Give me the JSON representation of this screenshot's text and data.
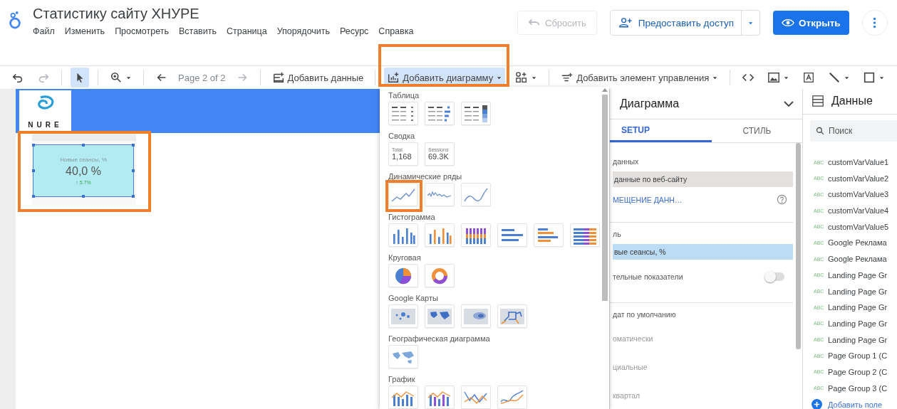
{
  "app": {
    "title": "Статистику сайту ХНУРЕ",
    "menu": [
      "Файл",
      "Изменить",
      "Просмотреть",
      "Вставить",
      "Страница",
      "Упорядочить",
      "Ресурс",
      "Справка"
    ]
  },
  "header_actions": {
    "reset": {
      "label": "Сбросить",
      "disabled": true
    },
    "share": {
      "label": "Предоставить доступ"
    },
    "open": {
      "label": "Открыть"
    }
  },
  "toolbar": [
    {
      "kind": "undo",
      "selected": false,
      "disabled": false
    },
    {
      "kind": "redo",
      "selected": false,
      "disabled": true
    },
    {
      "kind": "separator"
    },
    {
      "kind": "select",
      "selected": true,
      "disabled": false
    },
    {
      "kind": "separator"
    },
    {
      "kind": "zoom",
      "selected": false,
      "disabled": false,
      "caret": true
    },
    {
      "kind": "separator"
    },
    {
      "kind": "prev",
      "selected": false,
      "disabled": false
    },
    {
      "kind": "page",
      "label": "Page 2 of 2",
      "selected": false,
      "disabled": true
    },
    {
      "kind": "next",
      "selected": false,
      "disabled": true
    },
    {
      "kind": "separator"
    },
    {
      "kind": "add-data",
      "label": "Добавить данные",
      "selected": false,
      "disabled": false
    },
    {
      "kind": "separator"
    },
    {
      "kind": "add-chart",
      "label": "Добавить диаграмму",
      "selected": true,
      "disabled": false,
      "caret": true
    },
    {
      "kind": "component",
      "selected": false,
      "disabled": false,
      "caret": true
    },
    {
      "kind": "separator"
    },
    {
      "kind": "add-control",
      "label": "Добавить элемент управления",
      "selected": false,
      "disabled": false,
      "caret": true
    },
    {
      "kind": "separator"
    },
    {
      "kind": "code",
      "selected": false,
      "disabled": false
    },
    {
      "kind": "image",
      "selected": false,
      "disabled": false,
      "caret": true
    },
    {
      "kind": "text",
      "selected": false,
      "disabled": false
    },
    {
      "kind": "line",
      "selected": false,
      "disabled": false,
      "caret": true
    },
    {
      "kind": "shape",
      "selected": false,
      "disabled": false,
      "caret": true
    }
  ],
  "canvas": {
    "logo_text": "NURE",
    "scorecard": {
      "label": "Новые сеансы, %",
      "value": "40,0 %",
      "delta": "↑ 5.7%",
      "selected": true
    }
  },
  "chart_menu": {
    "sections": [
      {
        "title": "Таблица",
        "items": [
          {
            "kind": "table"
          },
          {
            "kind": "table-bars"
          },
          {
            "kind": "table-heatmap"
          }
        ]
      },
      {
        "title": "Сводка",
        "items": [
          {
            "kind": "scorecard",
            "label": "Total",
            "value": "1,168"
          },
          {
            "kind": "scorecard",
            "label": "Sessions",
            "value": "69.3K"
          }
        ]
      },
      {
        "title": "Динамические ряды",
        "items": [
          {
            "kind": "timeseries"
          },
          {
            "kind": "sparkline"
          },
          {
            "kind": "smooth-line"
          }
        ]
      },
      {
        "title": "Гистограмма",
        "items": [
          {
            "kind": "column"
          },
          {
            "kind": "grouped-column"
          },
          {
            "kind": "stacked-column"
          },
          {
            "kind": "bar"
          },
          {
            "kind": "grouped-bar"
          },
          {
            "kind": "stacked-bar"
          }
        ]
      },
      {
        "title": "Круговая",
        "items": [
          {
            "kind": "pie"
          },
          {
            "kind": "donut"
          }
        ]
      },
      {
        "title": "Google Карты",
        "items": [
          {
            "kind": "bubble-map"
          },
          {
            "kind": "filled-map"
          },
          {
            "kind": "heat-map"
          },
          {
            "kind": "line-map"
          }
        ]
      },
      {
        "title": "Географическая диаграмма",
        "items": [
          {
            "kind": "geo"
          }
        ]
      },
      {
        "title": "График",
        "items": [
          {
            "kind": "combo"
          },
          {
            "kind": "stacked-combo"
          },
          {
            "kind": "line"
          },
          {
            "kind": "smooth-combo"
          }
        ]
      }
    ]
  },
  "properties": {
    "title": "Диаграмма",
    "tabs": [
      {
        "label": "SETUP",
        "selected": true
      },
      {
        "label": "СТИЛЬ",
        "selected": false
      }
    ],
    "rows": [
      {
        "kind": "label",
        "text": "данных"
      },
      {
        "kind": "source",
        "text": "данные по веб-сайту"
      },
      {
        "kind": "link",
        "text": "МЕЩЕНИЕ ДАНН…"
      },
      {
        "kind": "divider"
      },
      {
        "kind": "label",
        "text": "ль"
      },
      {
        "kind": "chip",
        "text": "вые сеансы, %"
      },
      {
        "kind": "toggle",
        "text": "тельные показатели",
        "on": false
      },
      {
        "kind": "divider"
      },
      {
        "kind": "label",
        "text": "дат по умолчанию"
      },
      {
        "kind": "option",
        "text": "оматически"
      },
      {
        "kind": "option",
        "text": "циальные"
      },
      {
        "kind": "option",
        "text": "квартал"
      }
    ]
  },
  "data_panel": {
    "title": "Данные",
    "search": {
      "placeholder": "Поиск"
    },
    "fields": [
      {
        "type": "ABC",
        "name": "customVarValue1"
      },
      {
        "type": "ABC",
        "name": "customVarValue2"
      },
      {
        "type": "ABC",
        "name": "customVarValue3"
      },
      {
        "type": "ABC",
        "name": "customVarValue4"
      },
      {
        "type": "ABC",
        "name": "customVarValue5"
      },
      {
        "type": "ABC",
        "name": "Google Реклама"
      },
      {
        "type": "ABC",
        "name": "Google Реклама"
      },
      {
        "type": "ABC",
        "name": "Landing Page Gr"
      },
      {
        "type": "ABC",
        "name": "Landing Page Gr"
      },
      {
        "type": "ABC",
        "name": "Landing Page Gr"
      },
      {
        "type": "ABC",
        "name": "Landing Page Gr"
      },
      {
        "type": "ABC",
        "name": "Landing Page Gr"
      },
      {
        "type": "ABC",
        "name": "Page Group 1 (C"
      },
      {
        "type": "ABC",
        "name": "Page Group 2 (C"
      },
      {
        "type": "ABC",
        "name": "Page Group 3 (C"
      }
    ],
    "add_field": "Добавить поле"
  }
}
